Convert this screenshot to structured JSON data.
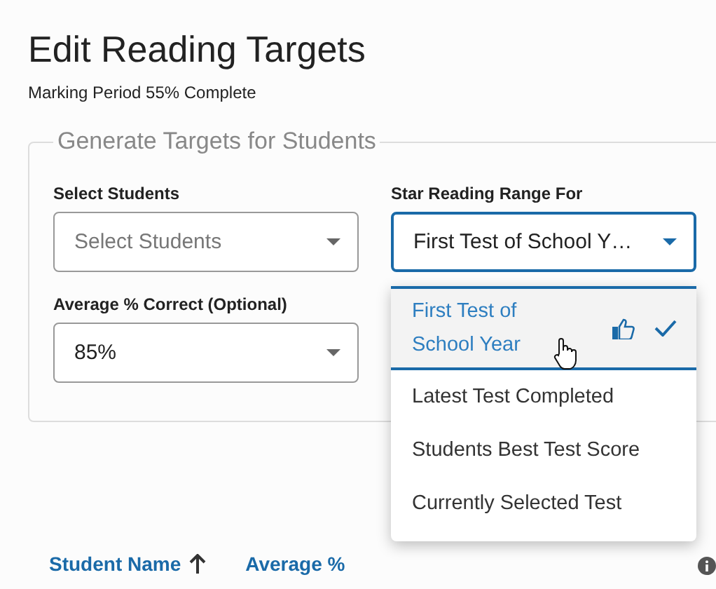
{
  "title": "Edit Reading Targets",
  "subtitle": "Marking Period 55% Complete",
  "section": {
    "legend": "Generate Targets for Students",
    "fields": [
      {
        "label": "Select Students",
        "placeholder": "Select Students",
        "open": false
      },
      {
        "label": "Star Reading Range For",
        "value": "First Test of School Y…",
        "open": true
      },
      {
        "label": "Average % Correct (Optional)",
        "value": "85%",
        "open": false
      }
    ]
  },
  "dropdown": {
    "options": [
      {
        "label": "First Test of School Year",
        "selected": true,
        "recommended": true
      },
      {
        "label": "Latest Test Completed",
        "selected": false,
        "recommended": false
      },
      {
        "label": "Students Best Test Score",
        "selected": false,
        "recommended": false
      },
      {
        "label": "Currently Selected Test",
        "selected": false,
        "recommended": false
      }
    ]
  },
  "table": {
    "columns": [
      {
        "label": "Student Name",
        "sorted": true
      },
      {
        "label": "Average %",
        "sorted": false
      }
    ]
  }
}
